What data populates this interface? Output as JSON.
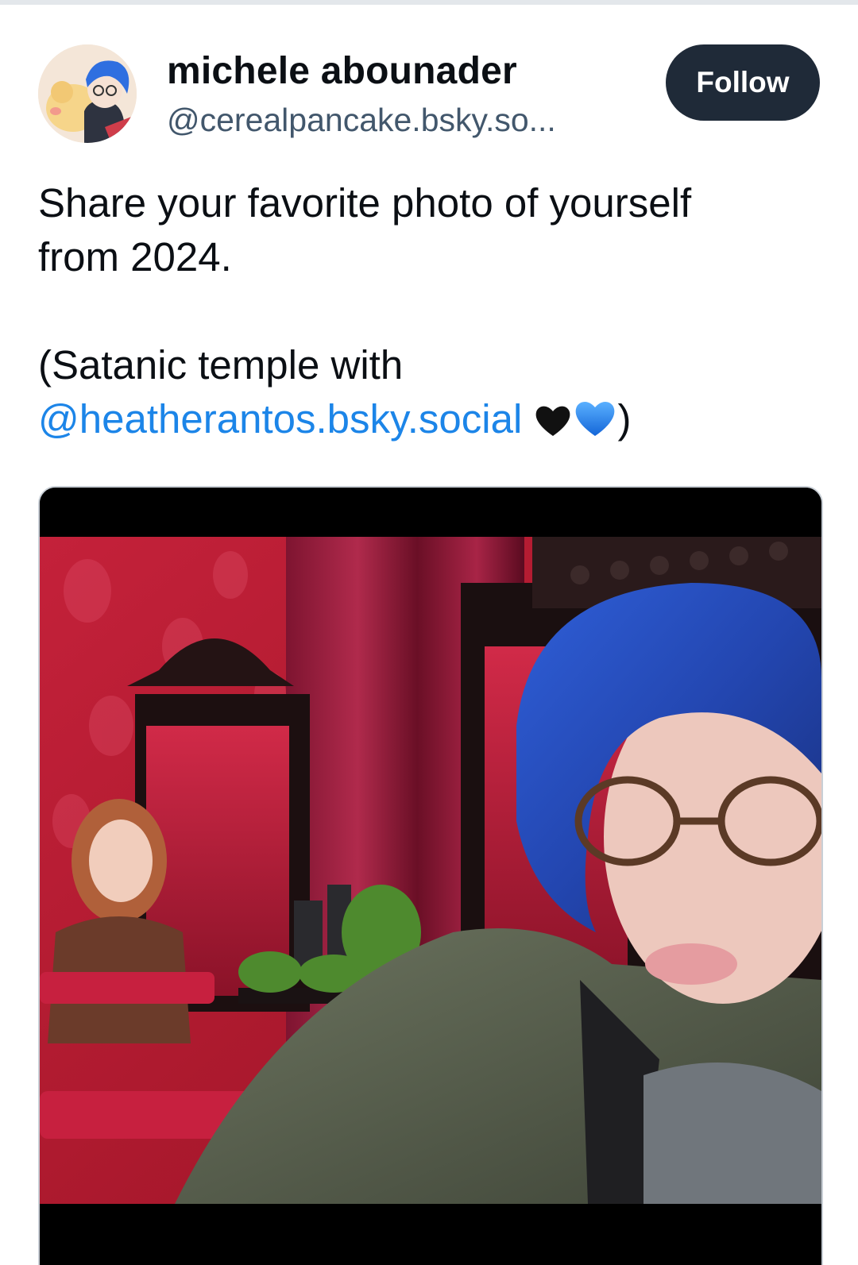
{
  "post": {
    "author": {
      "display_name": "michele abounader",
      "handle": "@cerealpancake.bsky.so..."
    },
    "follow_label": "Follow",
    "text": {
      "line1": "Share your favorite photo of yourself",
      "line2": "from 2024.",
      "line3": "(Satanic temple with",
      "mention": "@heatherantos.bsky.social",
      "closing": ")"
    },
    "emojis": [
      "black-heart-icon",
      "blue-heart-icon"
    ],
    "image": {
      "kind": "photo"
    }
  },
  "colors": {
    "accent_link": "#1c85e8",
    "follow_button_bg": "#1f2a38",
    "handle_text": "#42576c"
  }
}
